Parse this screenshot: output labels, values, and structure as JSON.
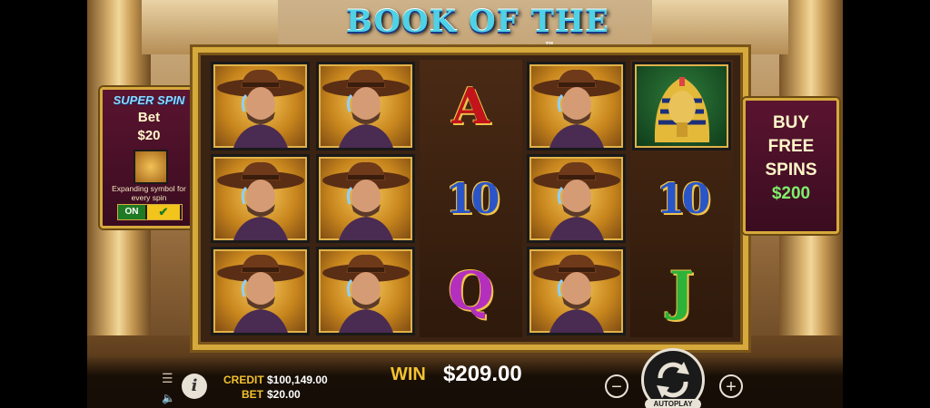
{
  "title": "BOOK OF THE FALLEN",
  "title_tm": "™",
  "super_spin": {
    "title": "SUPER SPIN",
    "bet_label": "Bet",
    "amount": "$20",
    "description": "Expanding symbol for every spin",
    "toggle_on": "ON",
    "toggle_check": "✔"
  },
  "buy": {
    "line1": "BUY",
    "line2": "FREE",
    "line3": "SPINS",
    "price": "$200"
  },
  "reels": [
    [
      "cowboy",
      "cowboy",
      "cowboy"
    ],
    [
      "cowboy",
      "cowboy",
      "cowboy"
    ],
    [
      "A",
      "10",
      "Q"
    ],
    [
      "cowboy",
      "cowboy",
      "cowboy"
    ],
    [
      "pharaoh",
      "10",
      "J"
    ]
  ],
  "symbols": {
    "A": "A",
    "10": "10",
    "Q": "Q",
    "J": "J"
  },
  "bottom": {
    "credit_label": "CREDIT",
    "credit_value": "$100,149.00",
    "bet_label": "BET",
    "bet_value": "$20.00",
    "win_label": "WIN",
    "win_value": "$209.00",
    "minus": "−",
    "plus": "+",
    "autoplay": "AUTOPLAY",
    "menu_icon": "☰",
    "sound_icon": "🔈",
    "info_icon": "i"
  },
  "colors": {
    "gold": "#d6a93c",
    "panel": "#5a1430",
    "win_yellow": "#f2c230"
  }
}
